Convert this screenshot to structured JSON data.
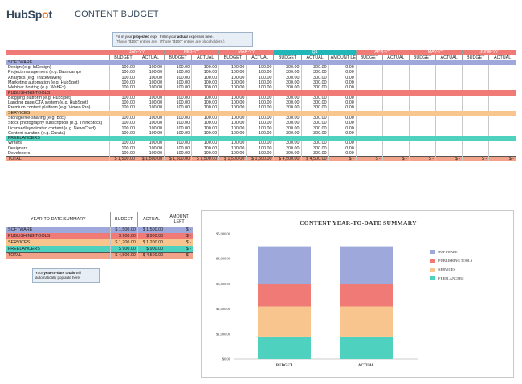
{
  "header": {
    "logo_text_1": "Hub",
    "logo_text_2": "Sp",
    "logo_text_3": "t",
    "title": "CONTENT BUDGET"
  },
  "callouts": [
    {
      "pre": "Fill in your ",
      "bold": "projected",
      "post": " expenses here.",
      "sub": "(Those \"$100\" entries are placeholders.)"
    },
    {
      "pre": "Fill in your ",
      "bold": "actual",
      "post": " expenses here.",
      "sub": "(Those \"$100\" entries are placeholders.)"
    },
    {
      "pre": "Your ",
      "bold": "year-to-date totals",
      "post": " will automatically populate here.",
      "sub": ""
    }
  ],
  "colors": {
    "software": "#9fa8da",
    "publishing": "#f07b76",
    "services": "#f9c58e",
    "freelancers": "#4fd1c0",
    "month_header": "#f07b76",
    "q1_header": "#1fb7b7",
    "total": "#f3a28a"
  },
  "months": [
    "JAN-YY",
    "FEB-YY",
    "MAR-YY",
    "Q1",
    "APR-YY",
    "MAY-YY",
    "JUNE-YY"
  ],
  "subheaders": {
    "budget": "BUDGET",
    "actual": "ACTUAL",
    "amount_left": "AMOUNT LEFT"
  },
  "sections": [
    {
      "name": "SOFTWARE",
      "key": "software",
      "items": [
        "Design (e.g. InDesign)",
        "Project management (e.g. Basecamp)",
        "Analytics (e.g. TrackMaven)",
        "Marketing automation (e.g. HubSpot)",
        "Webinar hosting (e.g. WebEx)"
      ]
    },
    {
      "name": "PUBLISHING TOOLS",
      "key": "publishing",
      "items": [
        "Blogging platform (e.g. HubSpot)",
        "Landing page/CTA system (e.g. HubSpot)",
        "Premium content platform (e.g. Vimeo Pro)"
      ]
    },
    {
      "name": "SERVICES",
      "key": "services",
      "items": [
        "Storage/file-sharing (e.g. Box)",
        "Stock photography subscription (e.g. ThinkStock)",
        "Licensed/syndicated content (e.g. NewsCred)",
        "Content curation (e.g. Curata)"
      ]
    },
    {
      "name": "FREELANCERS",
      "key": "freelancers",
      "items": [
        "Writers",
        "Designers",
        "Developers"
      ]
    }
  ],
  "cell_values": {
    "month": "100.00",
    "q1": "300.00",
    "left": "0.00"
  },
  "total_row": {
    "label": "TOTAL",
    "month_value": "$ 1,500.00",
    "q1_value": "$ 4,500.00",
    "q1_left": "$ -",
    "empty_value": "$ -"
  },
  "ytd": {
    "title": "YEAR-TO-DATE SUMMARY",
    "col_budget": "BUDGET",
    "col_actual": "ACTUAL",
    "col_left": "AMOUNT LEFT",
    "rows": [
      {
        "name": "SOFTWARE",
        "key": "software",
        "budget": "$ 1,500.00",
        "actual": "$ 1,500.00",
        "left": "$ -"
      },
      {
        "name": "PUBLISHING TOOLS",
        "key": "publishing",
        "budget": "$ 900.00",
        "actual": "$ 900.00",
        "left": "$ -"
      },
      {
        "name": "SERVICES",
        "key": "services",
        "budget": "$ 1,200.00",
        "actual": "$ 1,200.00",
        "left": "$ -"
      },
      {
        "name": "FREELANCERS",
        "key": "freelancers",
        "budget": "$ 900.00",
        "actual": "$ 900.00",
        "left": "$ -"
      }
    ],
    "total": {
      "name": "TOTAL",
      "budget": "$ 4,500.00",
      "actual": "$ 4,500.00",
      "left": "$ -"
    }
  },
  "chart_data": {
    "type": "bar",
    "stacked": true,
    "title": "CONTENT YEAR-TO-DATE SUMMARY",
    "categories": [
      "BUDGET",
      "ACTUAL"
    ],
    "series": [
      {
        "name": "SOFTWARE",
        "values": [
          1500,
          1500
        ],
        "color": "#9fa8da"
      },
      {
        "name": "PUBLISHING TOOLS",
        "values": [
          900,
          900
        ],
        "color": "#f07b76"
      },
      {
        "name": "SERVICES",
        "values": [
          1200,
          1200
        ],
        "color": "#f9c58e"
      },
      {
        "name": "FREELANCERS",
        "values": [
          900,
          900
        ],
        "color": "#4fd1c0"
      }
    ],
    "yticks": [
      "$0.00",
      "$1,000.00",
      "$2,000.00",
      "$3,000.00",
      "$4,000.00",
      "$5,000.00"
    ],
    "ylim": [
      0,
      5000
    ],
    "legend": "right"
  }
}
